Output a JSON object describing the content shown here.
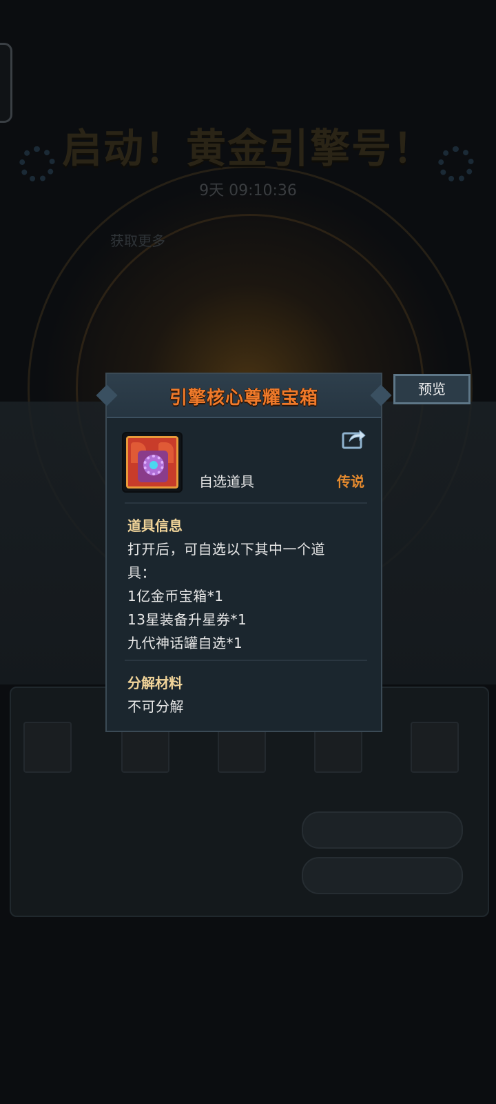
{
  "background": {
    "event_title": "启动！黄金引擎号！",
    "timer": "9天 09:10:36",
    "get_more_link": "获取更多"
  },
  "popup": {
    "title": "引擎核心尊耀宝箱",
    "item_type": "自选道具",
    "rarity": "传说",
    "info_section": {
      "title": "道具信息",
      "lines": [
        "打开后，可自选以下其中一个道",
        "具：",
        "1亿金币宝箱*1",
        "13星装备升星券*1",
        "九代神话罐自选*1"
      ]
    },
    "decompose_section": {
      "title": "分解材料",
      "value": "不可分解"
    }
  },
  "preview_button": {
    "label": "预览"
  },
  "colors": {
    "title_orange": "#f07a2a",
    "rarity_orange": "#e58a2e",
    "section_gold": "#f2d59a",
    "panel_bg": "#1b262e"
  }
}
